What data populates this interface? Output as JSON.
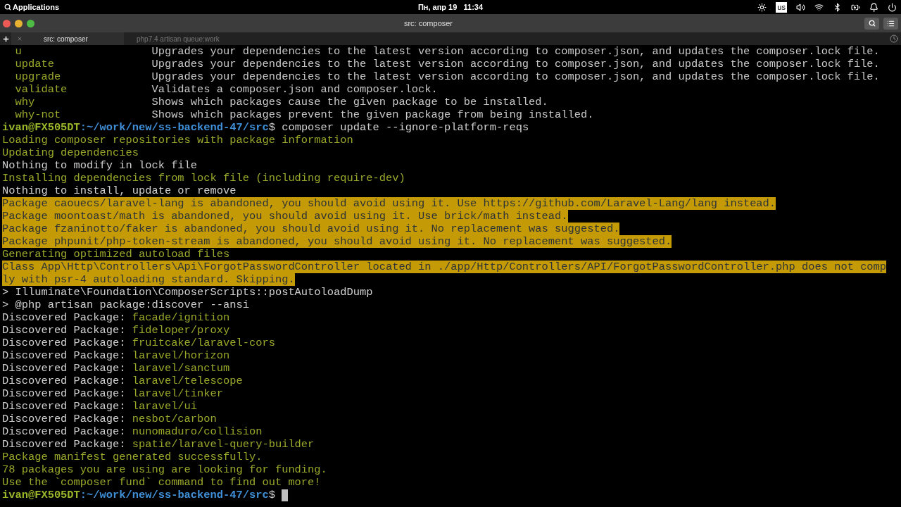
{
  "top_bar": {
    "menu": "Applications",
    "clock": "Пн, апр 19   11:34",
    "keyboard_layout": "us"
  },
  "window": {
    "title": "src: composer"
  },
  "tabs": [
    {
      "label": "src: composer",
      "selected": true
    },
    {
      "label": "php7.4 artisan queue:work",
      "selected": false
    }
  ],
  "terminal": {
    "lines": [
      {
        "kind": "help",
        "command": "u",
        "description": "Upgrades your dependencies to the latest version according to composer.json, and updates the composer.lock file."
      },
      {
        "kind": "help",
        "command": "update",
        "description": "Upgrades your dependencies to the latest version according to composer.json, and updates the composer.lock file."
      },
      {
        "kind": "help",
        "command": "upgrade",
        "description": "Upgrades your dependencies to the latest version according to composer.json, and updates the composer.lock file."
      },
      {
        "kind": "help",
        "command": "validate",
        "description": "Validates a composer.json and composer.lock."
      },
      {
        "kind": "help",
        "command": "why",
        "description": "Shows which packages cause the given package to be installed."
      },
      {
        "kind": "help",
        "command": "why-not",
        "description": "Shows which packages prevent the given package from being installed."
      },
      {
        "kind": "prompt",
        "user": "ivan@FX505DT",
        "path": ":~/work/new/ss-backend-47/src",
        "symbol": "$",
        "command": "composer update --ignore-platform-reqs"
      },
      {
        "kind": "info",
        "text": "Loading composer repositories with package information"
      },
      {
        "kind": "info",
        "text": "Updating dependencies"
      },
      {
        "kind": "plain",
        "text": "Nothing to modify in lock file"
      },
      {
        "kind": "info",
        "text": "Installing dependencies from lock file (including require-dev)"
      },
      {
        "kind": "plain",
        "text": "Nothing to install, update or remove"
      },
      {
        "kind": "warning",
        "text": "Package caouecs/laravel-lang is abandoned, you should avoid using it. Use https://github.com/Laravel-Lang/lang instead."
      },
      {
        "kind": "warning",
        "text": "Package moontoast/math is abandoned, you should avoid using it. Use brick/math instead."
      },
      {
        "kind": "warning",
        "text": "Package fzaninotto/faker is abandoned, you should avoid using it. No replacement was suggested."
      },
      {
        "kind": "warning",
        "text": "Package phpunit/php-token-stream is abandoned, you should avoid using it. No replacement was suggested."
      },
      {
        "kind": "info",
        "text": "Generating optimized autoload files"
      },
      {
        "kind": "warning",
        "text": "Class App\\Http\\Controllers\\Api\\ForgotPasswordController located in ./app/Http/Controllers/API/ForgotPasswordController.php does not comp"
      },
      {
        "kind": "warning",
        "text": "ly with psr-4 autoloading standard. Skipping."
      },
      {
        "kind": "plain",
        "text": "> Illuminate\\Foundation\\ComposerScripts::postAutoloadDump"
      },
      {
        "kind": "plain",
        "text": "> @php artisan package:discover --ansi"
      },
      {
        "kind": "discovered",
        "label": "Discovered Package:",
        "package": "facade/ignition"
      },
      {
        "kind": "discovered",
        "label": "Discovered Package:",
        "package": "fideloper/proxy"
      },
      {
        "kind": "discovered",
        "label": "Discovered Package:",
        "package": "fruitcake/laravel-cors"
      },
      {
        "kind": "discovered",
        "label": "Discovered Package:",
        "package": "laravel/horizon"
      },
      {
        "kind": "discovered",
        "label": "Discovered Package:",
        "package": "laravel/sanctum"
      },
      {
        "kind": "discovered",
        "label": "Discovered Package:",
        "package": "laravel/telescope"
      },
      {
        "kind": "discovered",
        "label": "Discovered Package:",
        "package": "laravel/tinker"
      },
      {
        "kind": "discovered",
        "label": "Discovered Package:",
        "package": "laravel/ui"
      },
      {
        "kind": "discovered",
        "label": "Discovered Package:",
        "package": "nesbot/carbon"
      },
      {
        "kind": "discovered",
        "label": "Discovered Package:",
        "package": "nunomaduro/collision"
      },
      {
        "kind": "discovered",
        "label": "Discovered Package:",
        "package": "spatie/laravel-query-builder"
      },
      {
        "kind": "info",
        "text": "Package manifest generated successfully."
      },
      {
        "kind": "info",
        "text": "78 packages you are using are looking for funding."
      },
      {
        "kind": "info",
        "text": "Use the `composer fund` command to find out more!"
      },
      {
        "kind": "prompt",
        "user": "ivan@FX505DT",
        "path": ":~/work/new/ss-backend-47/src",
        "symbol": "$",
        "cursor": true
      }
    ]
  }
}
